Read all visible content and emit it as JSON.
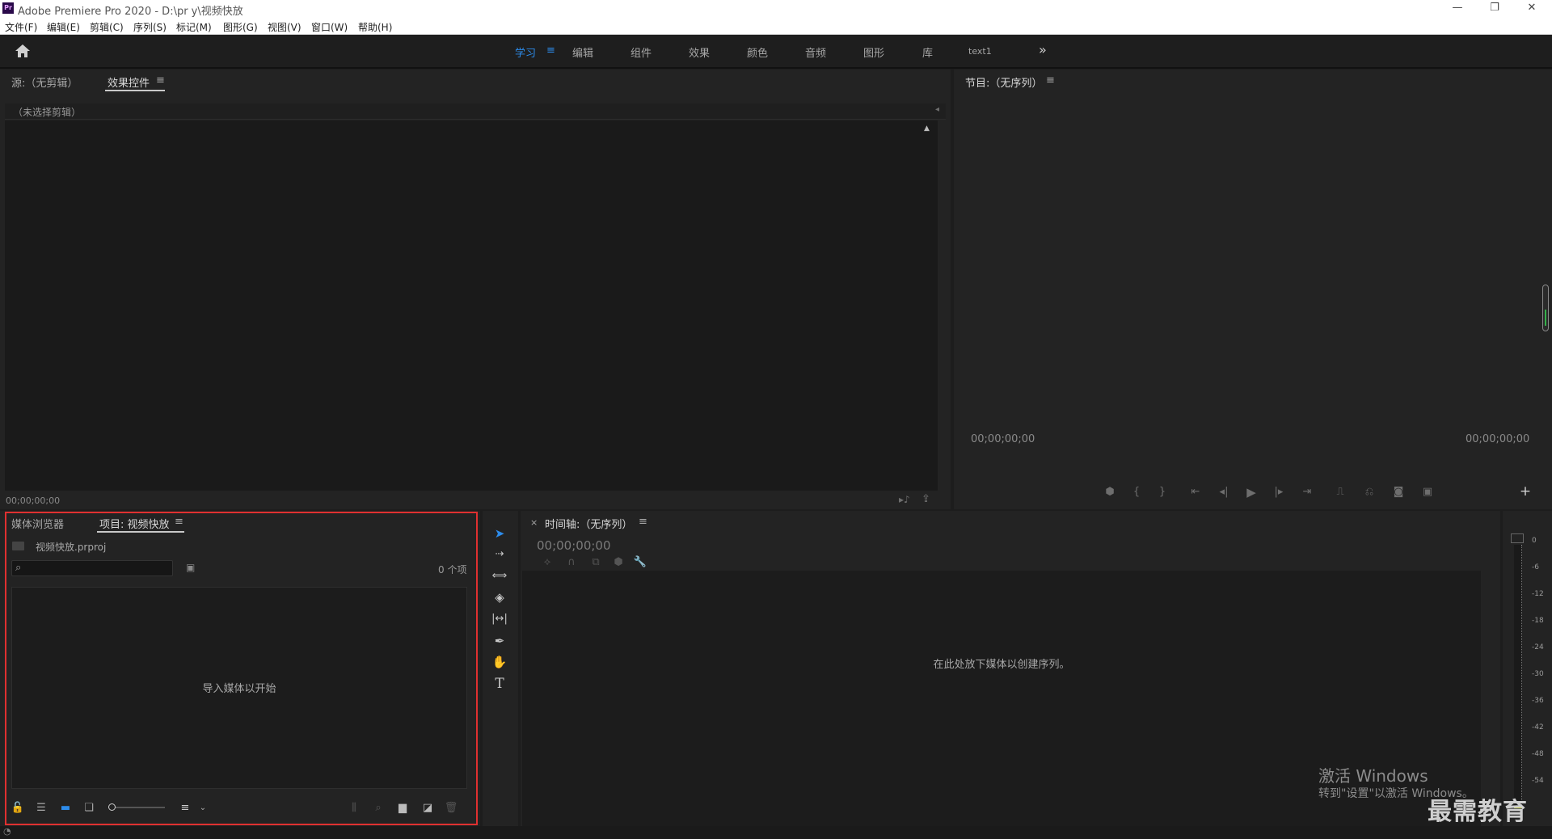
{
  "window": {
    "title": "Adobe Premiere Pro 2020 - D:\\pr y\\视频快放",
    "logo": "Pr"
  },
  "menu": [
    "文件(F)",
    "编辑(E)",
    "剪辑(C)",
    "序列(S)",
    "标记(M)",
    "图形(G)",
    "视图(V)",
    "窗口(W)",
    "帮助(H)"
  ],
  "workspaces": {
    "tabs": [
      "学习",
      "编辑",
      "组件",
      "效果",
      "颜色",
      "音频",
      "图形",
      "库",
      "text1"
    ],
    "active": "学习",
    "more": "»"
  },
  "source_panel": {
    "tab_source": "源:（无剪辑）",
    "tab_effect_controls": "效果控件",
    "no_clip": "（未选择剪辑）",
    "timecode": "00;00;00;00"
  },
  "program_panel": {
    "title": "节目:（无序列）",
    "timecode_left": "00;00;00;00",
    "timecode_right": "00;00;00;00"
  },
  "project_panel": {
    "tab_media_browser": "媒体浏览器",
    "tab_project": "项目: 视频快放",
    "file": "视频快放.prproj",
    "item_count": "0 个项",
    "empty_text": "导入媒体以开始"
  },
  "timeline_panel": {
    "close": "×",
    "title": "时间轴:（无序列）",
    "timecode": "00;00;00;00",
    "empty_text": "在此处放下媒体以创建序列。"
  },
  "audio_meter": {
    "ticks": [
      "0",
      "-6",
      "-12",
      "-18",
      "-24",
      "-30",
      "-36",
      "-42",
      "-48",
      "-54"
    ]
  },
  "watermark": {
    "line1": "激活 Windows",
    "line2": "转到\"设置\"以激活 Windows。",
    "brand": "最需教育"
  },
  "colors": {
    "accent": "#2d8ceb",
    "highlight_box": "#e03030",
    "active_green": "#35b04a"
  }
}
